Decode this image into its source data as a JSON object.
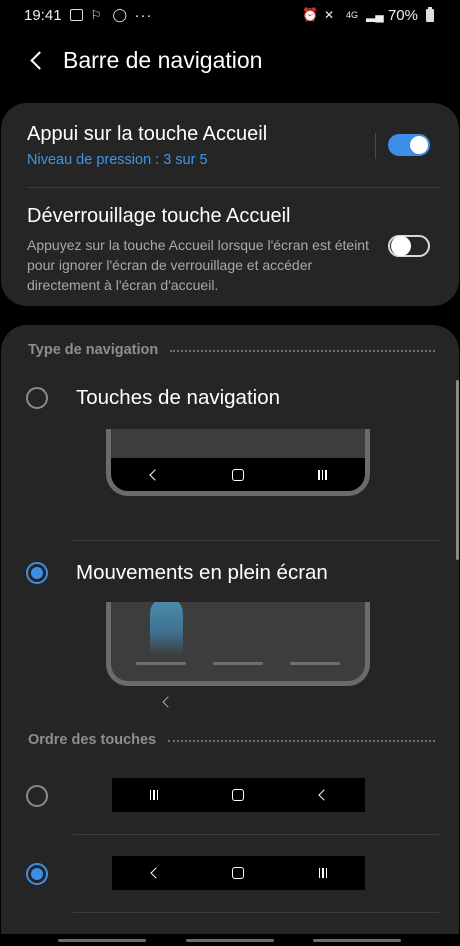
{
  "status_bar": {
    "time": "19:41",
    "overflow": "···",
    "network": "4G",
    "battery": "70%",
    "left_icons": [
      "image-icon",
      "notification-icon",
      "whatsapp-icon"
    ],
    "right_icons": [
      "alarm-icon",
      "mute-icon",
      "signal-icon",
      "battery-icon"
    ]
  },
  "header": {
    "title": "Barre de navigation",
    "back_icon": "chevron-left-icon"
  },
  "settings": {
    "home_press": {
      "title": "Appui sur la touche Accueil",
      "subtitle": "Niveau de pression : 3 sur 5",
      "enabled": true
    },
    "home_unlock": {
      "title": "Déverrouillage touche Accueil",
      "description": "Appuyez sur la touche Accueil lorsque l'écran est éteint pour ignorer l'écran de verrouillage et accéder directement à l'écran d'accueil.",
      "enabled": false
    }
  },
  "navigation_type": {
    "header": "Type de navigation",
    "options": [
      {
        "label": "Touches de navigation",
        "selected": false
      },
      {
        "label": "Mouvements en plein écran",
        "selected": true
      }
    ]
  },
  "button_order": {
    "header": "Ordre des touches",
    "options": [
      {
        "buttons": [
          "recent-apps-icon",
          "home-icon",
          "back-icon"
        ],
        "selected": false
      },
      {
        "buttons": [
          "back-icon",
          "home-icon",
          "recent-apps-icon"
        ],
        "selected": true
      }
    ]
  },
  "colors": {
    "accent": "#3c8fe6",
    "card_bg": "#252525",
    "background": "#000000"
  }
}
